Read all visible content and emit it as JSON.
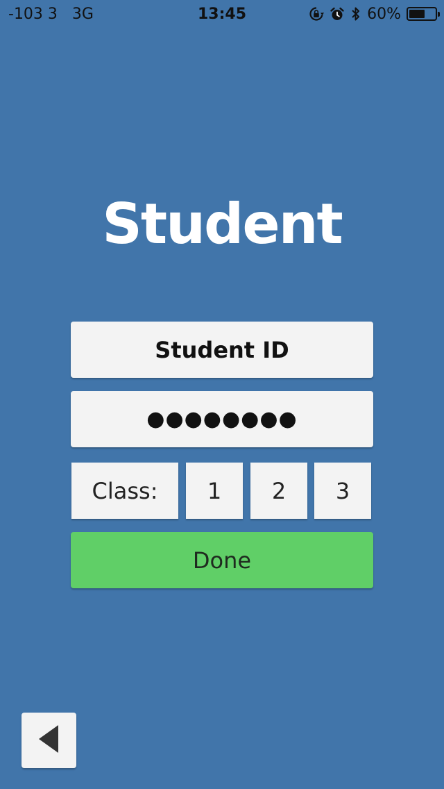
{
  "status_bar": {
    "signal_text": "-103 3   3G",
    "time": "13:45",
    "battery_percent_text": "60%",
    "battery_level": 0.6,
    "icons": [
      "rotation-lock-icon",
      "alarm-icon",
      "bluetooth-icon",
      "battery-icon"
    ]
  },
  "screen": {
    "title": "Student"
  },
  "form": {
    "student_id_text": "Student ID",
    "password_text": "●●●●●●●●",
    "class_label": "Class:",
    "class_options": [
      "1",
      "2",
      "3"
    ],
    "done_label": "Done"
  },
  "navigation": {
    "back_icon": "back-triangle-icon"
  },
  "colors": {
    "background": "#4175aa",
    "field_background": "#f3f3f3",
    "done_button": "#60cf67"
  }
}
